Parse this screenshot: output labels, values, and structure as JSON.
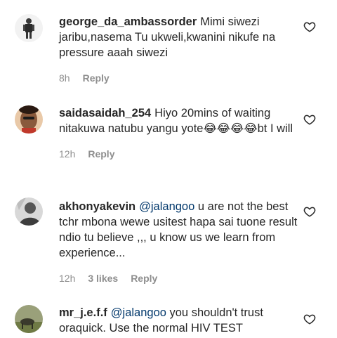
{
  "comments": [
    {
      "username": "george_da_ambassorder",
      "mention": "",
      "text": "Mimi siwezi jaribu,nasema Tu ukweli,kwanini nikufe na pressure aaah siwezi",
      "time": "8h",
      "likes": "",
      "reply_label": "Reply"
    },
    {
      "username": "saidasaidah_254",
      "mention": "",
      "text": "Hiyo 20mins of waiting nitakuwa natubu yangu yote😂😂😂😂bt I will",
      "time": "12h",
      "likes": "",
      "reply_label": "Reply"
    },
    {
      "username": "akhonyakevin",
      "mention": "@jalangoo",
      "text": " u are not the best tchr mbona wewe usitest hapa sai tuone result ndio tu believe ,,, u know us we learn from experience...",
      "time": "12h",
      "likes": "3 likes",
      "reply_label": "Reply"
    },
    {
      "username": "mr_j.e.f.f",
      "mention": "@jalangoo",
      "text": " you shouldn't trust oraquick. Use the normal HIV TEST",
      "time": "",
      "likes": "",
      "reply_label": ""
    }
  ],
  "icons": {
    "like": "heart-outline-icon"
  },
  "colors": {
    "text": "#262626",
    "meta": "#8e8e8e",
    "mention": "#00376b"
  }
}
